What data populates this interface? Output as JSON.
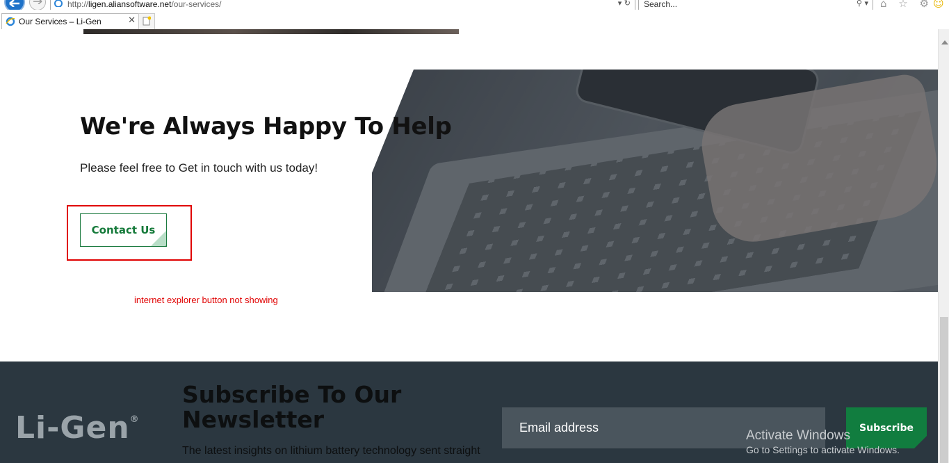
{
  "browser": {
    "url_prefix": "http://",
    "url_domain": "ligen.aliansoftware.net",
    "url_path": "/our-services/",
    "search_placeholder": "Search...",
    "tab_title": "Our Services – Li-Gen",
    "tab_close": "✕",
    "addr_controls": "▾ ↻",
    "search_controls": "⚲ ▾",
    "toolbar_icons": "⌂ ☆ ⚙",
    "smile": "☺"
  },
  "help": {
    "title": "We're Always Happy To Help",
    "subtitle": "Please feel free to Get in touch with us today!",
    "contact_label": "Contact Us",
    "annotation": "internet explorer button not showing"
  },
  "footer": {
    "logo": "Li-Gen",
    "logo_mark": "®",
    "newsletter_title": "Subscribe To Our Newsletter",
    "newsletter_text": "The latest insights on lithium battery technology sent straight",
    "email_placeholder": "Email address",
    "subscribe_label": "Subscribe"
  },
  "watermark": {
    "line1": "Activate Windows",
    "line2": "Go to Settings to activate Windows."
  },
  "colors": {
    "brand_green": "#117d3f",
    "footer_bg": "#2b3740",
    "annotation_red": "#e00000"
  }
}
